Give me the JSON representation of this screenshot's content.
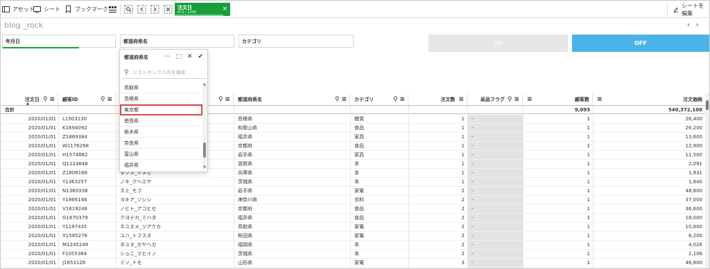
{
  "toolbar": {
    "assets_label": "アセット",
    "sheets_label": "シート",
    "bookmarks_label": "ブックマーク",
    "selection_chip": {
      "title": "注文日",
      "count": "872 / 1000",
      "close": "×"
    },
    "edit_sheet_label": "シートを編集"
  },
  "sheet": {
    "title": "blog _rock",
    "prev": "‹",
    "next": "›"
  },
  "filters": {
    "order_month": "年月日",
    "prefecture": "都道府県名",
    "category": "カテゴリ"
  },
  "toggle": {
    "on_label": "ON",
    "off_label": "OFF"
  },
  "listbox": {
    "title": "都道府県名",
    "search_placeholder": "リストボックス内を検索",
    "items": [
      "鳥取県",
      "島根県",
      "東京都",
      "徳島県",
      "栃木県",
      "奈良県",
      "富山県",
      "福井県"
    ],
    "selected_index": 2
  },
  "table": {
    "headers": {
      "order_date": "注文日",
      "customer_id": "顧客ID",
      "prefecture": "都道府県名",
      "category": "カテゴリ",
      "order_count": "注文数",
      "return_flag": "返品フラグ",
      "customer_count": "顧客数",
      "order_price": "注文価格"
    },
    "total": {
      "label": "合計",
      "customer_count": "9,093",
      "order_price": "540,372,100"
    },
    "rows": [
      [
        "2020/01/01",
        "L1503130",
        "",
        "島根県",
        "雑貨",
        "1",
        "-",
        "1",
        "26,400"
      ],
      [
        "2020/01/01",
        "K1694092",
        "",
        "和歌山県",
        "食品",
        "1",
        "-",
        "1",
        "26,200"
      ],
      [
        "2020/01/01",
        "Z1869384",
        "",
        "福井県",
        "家具",
        "1",
        "-",
        "1",
        "13,600"
      ],
      [
        "2020/01/01",
        "W1176268",
        "",
        "京都府",
        "食品",
        "1",
        "-",
        "1",
        "12,900"
      ],
      [
        "2020/01/01",
        "H1574682",
        "",
        "岩手県",
        "家具",
        "1",
        "-",
        "1",
        "11,500"
      ],
      [
        "2020/01/01",
        "Q1124648",
        "",
        "滋賀県",
        "本",
        "1",
        "-",
        "1",
        "2,091"
      ],
      [
        "2020/01/01",
        "Z1808168",
        "タツメ_トメセ",
        "兵庫県",
        "本",
        "1",
        "-",
        "1",
        "1,931"
      ],
      [
        "2020/01/01",
        "Y1363257",
        "ノキ_クヘエヤ",
        "茨城県",
        "本",
        "1",
        "-",
        "1",
        "1,840"
      ],
      [
        "2020/01/01",
        "N1360338",
        "スミ_モフ",
        "岩手県",
        "家電",
        "2",
        "-",
        "1",
        "48,800"
      ],
      [
        "2020/01/01",
        "Y1866146",
        "ヨキア_ソシシ",
        "神奈川県",
        "衣料",
        "2",
        "-",
        "1",
        "37,000"
      ],
      [
        "2020/01/01",
        "V1619248",
        "ノヒト_アコヒセ",
        "京都府",
        "食品",
        "2",
        "-",
        "1",
        "36,600"
      ],
      [
        "2020/01/01",
        "G1670379",
        "クヨテカ_ミハタ",
        "福井県",
        "食品",
        "2",
        "-",
        "1",
        "18,000"
      ],
      [
        "2020/01/01",
        "Y1197435",
        "ネユヌメ_ツアクカ",
        "鳥取県",
        "家電",
        "2",
        "-",
        "1",
        "10,800"
      ],
      [
        "2020/01/01",
        "X1585276",
        "ユハ_トフスヌ",
        "秋田県",
        "家電",
        "2",
        "-",
        "1",
        "6,200"
      ],
      [
        "2020/01/01",
        "M1245249",
        "タユヌ_カヤヘカ",
        "福岡県",
        "本",
        "2",
        "-",
        "1",
        "4,026"
      ],
      [
        "2020/01/01",
        "F1055384",
        "ショニ_マヒイノ",
        "茨城県",
        "本",
        "2",
        "-",
        "1",
        "2,106"
      ],
      [
        "2020/01/01",
        "J1653126",
        "ミソ_トモ",
        "山形県",
        "家電",
        "3",
        "-",
        "1",
        "46,800"
      ]
    ]
  }
}
